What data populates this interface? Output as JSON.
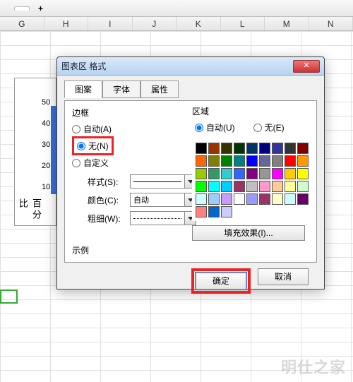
{
  "sheet": {
    "tab1": "",
    "columns": [
      "G",
      "H",
      "I",
      "J",
      "K",
      "L",
      "M",
      "N"
    ]
  },
  "chart": {
    "ylabel": "百分比",
    "ticks": [
      "50",
      "40",
      "30",
      "20",
      "10"
    ]
  },
  "dialog": {
    "title": "图表区 格式",
    "tabs": {
      "pattern": "图案",
      "font": "字体",
      "attr": "属性"
    },
    "border": {
      "title": "边框",
      "auto": "自动(A)",
      "none": "无(N)",
      "custom": "自定义",
      "style": "样式(S):",
      "color": "颜色(C):",
      "colorValue": "自动",
      "weight": "粗细(W):"
    },
    "area": {
      "title": "区域",
      "auto": "自动(U)",
      "none": "无(E)",
      "fill": "填充效果(I)..."
    },
    "example": "示例",
    "ok": "确定",
    "cancel": "取消"
  },
  "palette": [
    "#000000",
    "#993300",
    "#333300",
    "#003300",
    "#003366",
    "#000080",
    "#333399",
    "#333333",
    "#800000",
    "#ff6600",
    "#808000",
    "#008000",
    "#008080",
    "#0000ff",
    "#666699",
    "#808080",
    "#ff0000",
    "#ff9900",
    "#99cc00",
    "#339966",
    "#33cccc",
    "#3366ff",
    "#800080",
    "#969696",
    "#ff00ff",
    "#ffcc00",
    "#ffff00",
    "#00ff00",
    "#00ffff",
    "#00ccff",
    "#993366",
    "#c0c0c0",
    "#ff99cc",
    "#ffcc99",
    "#ffff99",
    "#ccffcc",
    "#ccffff",
    "#99ccff",
    "#cc99ff",
    "#ffffff",
    "#9999ff",
    "#993366",
    "#ffffcc",
    "#ccffff",
    "#660066",
    "#ff8080",
    "#0066cc",
    "#ccccff"
  ],
  "watermark": "明仕之家"
}
